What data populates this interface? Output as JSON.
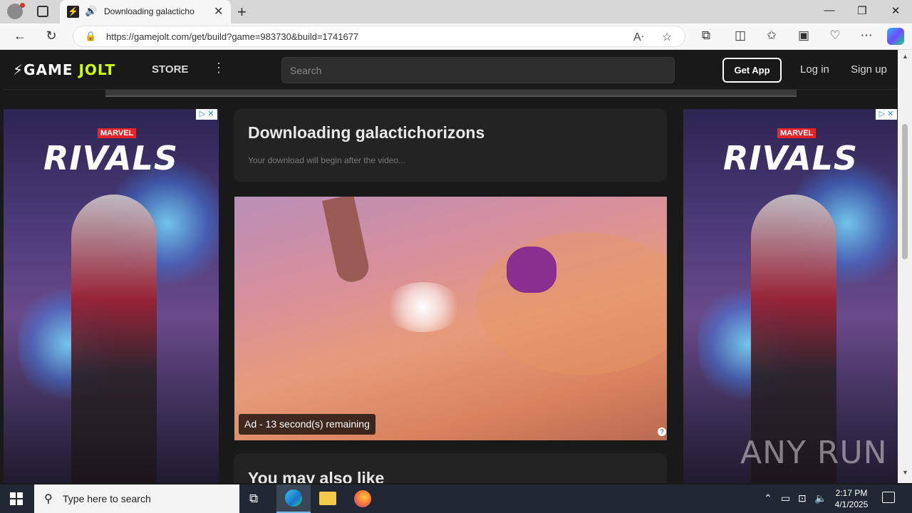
{
  "browser": {
    "tab_title": "Downloading galacticho",
    "url": "https://gamejolt.com/get/build?game=983730&build=1741677"
  },
  "gamejolt": {
    "logo_game": "GAME",
    "logo_jolt": "JOLT",
    "store_label": "STORE",
    "search_placeholder": "Search",
    "get_app_label": "Get App",
    "login_label": "Log in",
    "signup_label": "Sign up"
  },
  "ads": {
    "brand": "MARVEL",
    "title": "RIVALS"
  },
  "download": {
    "title": "Downloading galactichorizons",
    "subtitle": "Your download will begin after the video..."
  },
  "video_ad": {
    "remaining_text": "Ad - 13 second(s) remaining"
  },
  "also_like": {
    "title": "You may also like"
  },
  "watermark": "ANY RUN",
  "taskbar": {
    "search_placeholder": "Type here to search",
    "time": "2:17 PM",
    "date": "4/1/2025"
  }
}
